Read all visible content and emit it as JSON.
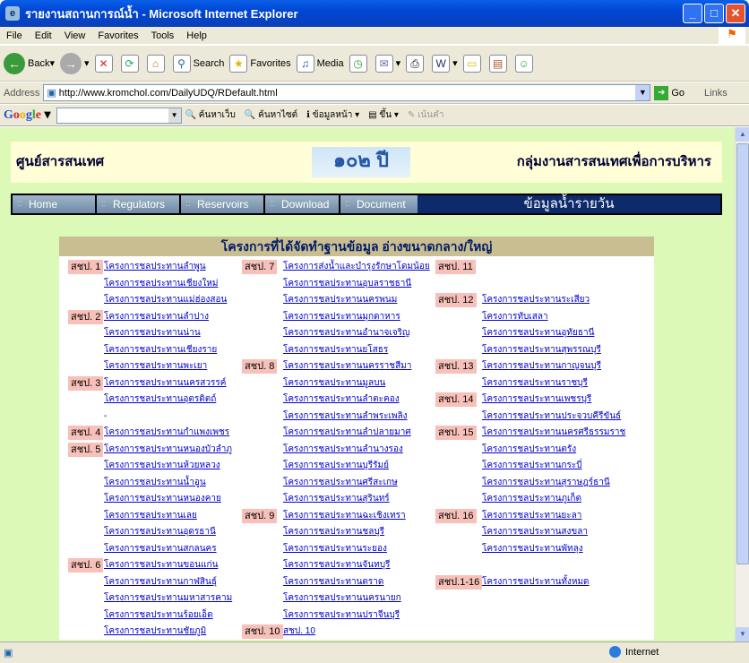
{
  "window": {
    "title": "รายงานสถานการณ์น้ำ - Microsoft Internet Explorer"
  },
  "menu": [
    "File",
    "Edit",
    "View",
    "Favorites",
    "Tools",
    "Help"
  ],
  "toolbar": {
    "back": "Back",
    "search": "Search",
    "favorites": "Favorites",
    "media": "Media"
  },
  "address": {
    "label": "Address",
    "url": "http://www.kromchol.com/DailyUDQ/RDefault.html",
    "go": "Go",
    "links": "Links"
  },
  "google": {
    "logo": "Google",
    "search_web": "ค้นหาเว็บ",
    "search_site": "ค้นหาไซต์",
    "pageinfo": "ข้อมูลหน้า",
    "up": "ขึ้น",
    "highlight": "เน้นคำ"
  },
  "site": {
    "left_title": "ศูนย์สารสนเทศ",
    "right_title": "กลุ่มงานสารสนเทศเพื่อการบริหาร",
    "logo_text": "๑๐๒ ปี",
    "nav": [
      "Home",
      "Regulators",
      "Reservoirs",
      "Download",
      "Document"
    ],
    "nav_title": "ข้อมูลน้ำรายวัน",
    "panel_title": "โครงการที่ได้จัดทำฐานข้อมูล อ่างขนาดกลาง/ใหญ่"
  },
  "columns": [
    [
      {
        "sec": "สชป. 1",
        "items": [
          "โครงการชลประทานลำพูน",
          "โครงการชลประทานเชียงใหม่",
          "โครงการชลประทานแม่ฮ่องสอน"
        ]
      },
      {
        "sec": "สชป. 2",
        "items": [
          "โครงการชลประทานลำปาง",
          "โครงการชลประทานน่าน",
          "โครงการชลประทานเชียงราย",
          "โครงการชลประทานพะเยา"
        ]
      },
      {
        "sec": "สชป. 3",
        "items": [
          "โครงการชลประทานนครสวรรค์",
          "โครงการชลประทานอุตรดิตถ์",
          "-"
        ]
      },
      {
        "sec": "สชป. 4",
        "items": [
          "โครงการชลประทานกำแพงเพชร"
        ]
      },
      {
        "sec": "สชป. 5",
        "items": [
          "โครงการชลประทานหนองบัวลำภู",
          "โครงการชลประทานห้วยหลวง",
          "โครงการชลประทานน้ำอูน",
          "โครงการชลประทานหนองคาย",
          "โครงการชลประทานเลย",
          "โครงการชลประทานอุดรธานี",
          "โครงการชลประทานสกลนคร"
        ]
      },
      {
        "sec": "สชป. 6",
        "items": [
          "โครงการชลประทานขอนแก่น",
          "โครงการชลประทานกาฬสินธุ์",
          "โครงการชลประทานมหาสารคาม",
          "โครงการชลประทานร้อยเอ็ด",
          "โครงการชลประทานชัยภูมิ"
        ]
      }
    ],
    [
      {
        "sec": "สชป. 7",
        "items": [
          "โครงการส่งน้ำและบำรุงรักษาโดมน้อย",
          "โครงการชลประทานอุบลราชธานี",
          "โครงการชลประทานนครพนม",
          "โครงการชลประทานมุกดาหาร",
          "โครงการชลประทานอำนาจเจริญ",
          "โครงการชลประทานยโสธร"
        ]
      },
      {
        "sec": "สชป. 8",
        "items": [
          "โครงการชลประทานนครราชสีมา",
          "โครงการชลประทานมูลบน",
          "โครงการชลประทานลำตะคอง",
          "โครงการชลประทานลำพระเพลิง",
          "โครงการชลประทานลำปลายมาศ",
          "โครงการชลประทานลำนางรอง",
          "โครงการชลประทานบุรีรัมย์",
          "โครงการชลประทานศรีสะเกษ",
          "โครงการชลประทานสุรินทร์"
        ]
      },
      {
        "sec": "สชป. 9",
        "items": [
          "โครงการชลประทานฉะเชิงเทรา",
          "โครงการชลประทานชลบุรี",
          "โครงการชลประทานระยอง",
          "โครงการชลประทานจันทบุรี",
          "โครงการชลประทานตราด",
          "โครงการชลประทานนครนายก",
          "โครงการชลประทานปราจีนบุรี"
        ]
      },
      {
        "sec": "สชป. 10",
        "items": [
          "สชป. 10"
        ]
      }
    ],
    [
      {
        "sec": "สชป. 11",
        "items": []
      },
      {
        "sec": "สชป. 12",
        "items": [
          "โครงการชลประทานระเสียว",
          "โครงการทับเสลา",
          "โครงการชลประทานอุทัยธานี",
          "โครงการชลประทานสุพรรณบุรี"
        ]
      },
      {
        "sec": "สชป. 13",
        "items": [
          "โครงการชลประทานกาญจนบุรี",
          "โครงการชลประทานราชบุรี"
        ]
      },
      {
        "sec": "สชป. 14",
        "items": [
          "โครงการชลประทานเพชรบุรี",
          "โครงการชลประทานประจวบคีรีขันธ์"
        ]
      },
      {
        "sec": "สชป. 15",
        "items": [
          "โครงการชลประทานนครศรีธรรมราช",
          "โครงการชลประทานตรัง",
          "โครงการชลประทานกระบี่",
          "โครงการชลประทานสุราษฎร์ธานี",
          "โครงการชลประทานภูเก็ต"
        ]
      },
      {
        "sec": "สชป. 16",
        "items": [
          "โครงการชลประทานยะลา",
          "โครงการชลประทานสงขลา",
          "โครงการชลประทานพัทลุง"
        ]
      },
      {
        "sec": "สชป.1-16",
        "items": [
          "โครงการชลประทานทั้งหมด"
        ]
      }
    ]
  ],
  "status": {
    "zone": "Internet"
  }
}
